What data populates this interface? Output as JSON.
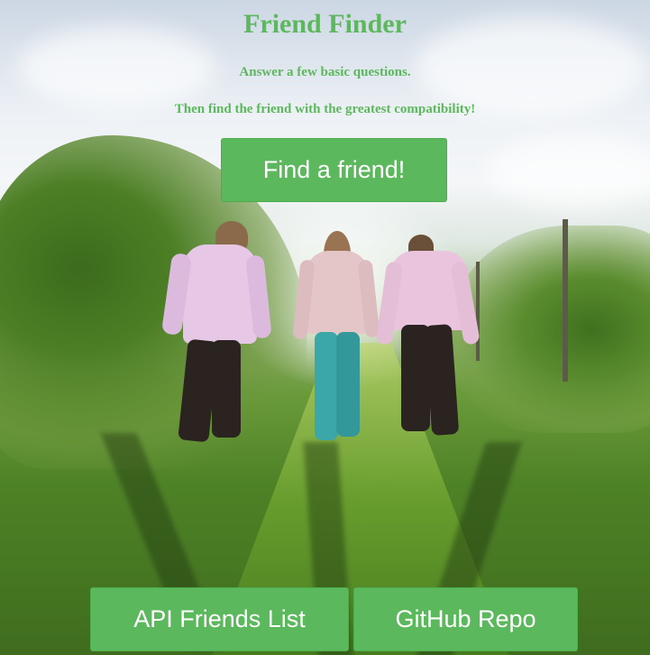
{
  "app": {
    "title": "Friend Finder",
    "tagline_1": "Answer a few basic questions.",
    "tagline_2": "Then find the friend with the greatest compatibility!"
  },
  "buttons": {
    "find_label": "Find a friend!",
    "api_label": "API Friends List",
    "github_label": "GitHub Repo"
  },
  "colors": {
    "accent": "#5cb85c",
    "button_text": "#ffffff"
  },
  "background": {
    "description_icon": "photo-friends-walking-vineyard"
  }
}
